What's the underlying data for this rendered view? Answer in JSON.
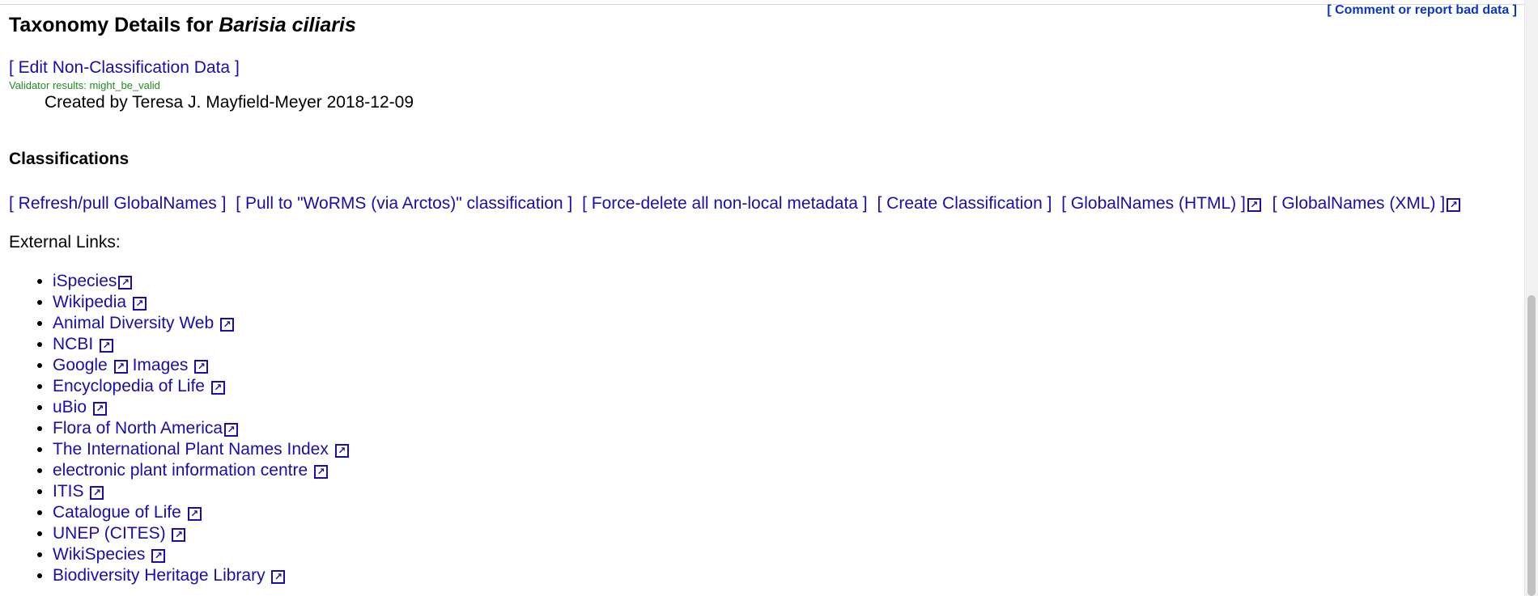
{
  "report_link": "[ Comment or report bad data ]",
  "title": {
    "prefix": "Taxonomy Details for",
    "taxon": "Barisia ciliaris"
  },
  "edit_link": "[ Edit Non-Classification Data ]",
  "validator": "Validator results: might_be_valid",
  "created": "Created by Teresa J. Mayfield-Meyer 2018-12-09",
  "classifications_heading": "Classifications",
  "actions": {
    "refresh": "[ Refresh/pull GlobalNames ]",
    "pull_worms": "[ Pull to \"WoRMS (via Arctos)\" classification ]",
    "force_delete": "[ Force-delete all non-local metadata ]",
    "create": "[ Create Classification ]",
    "gn_html": "[ GlobalNames (HTML) ]",
    "gn_xml": "[ GlobalNames (XML) ]"
  },
  "external_label": "External Links:",
  "external_links": {
    "ispecies": "iSpecies",
    "wikipedia": "Wikipedia",
    "adw": "Animal Diversity Web",
    "ncbi": "NCBI",
    "google": "Google",
    "images": "Images",
    "eol": "Encyclopedia of Life",
    "ubio": "uBio",
    "fna": "Flora of North America",
    "ipni": "The International Plant Names Index",
    "epic": "electronic plant information centre",
    "itis": "ITIS",
    "col": "Catalogue of Life",
    "cites": "UNEP (CITES)",
    "wikispecies": "WikiSpecies",
    "bhl": "Biodiversity Heritage Library"
  },
  "icons": {
    "external": "external-link-icon"
  },
  "colors": {
    "link": "#1a0dab",
    "validator": "#228b22"
  }
}
